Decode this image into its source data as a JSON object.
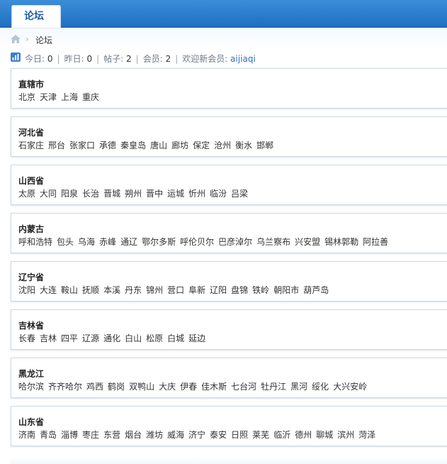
{
  "tabs": {
    "forum": "论坛"
  },
  "breadcrumb": {
    "current": "论坛"
  },
  "stats": {
    "today_label": "今日:",
    "today_value": "0",
    "yesterday_label": "昨日:",
    "yesterday_value": "0",
    "posts_label": "帖子:",
    "posts_value": "2",
    "members_label": "会员:",
    "members_value": "2",
    "welcome_label": "欢迎新会员:",
    "welcome_user": "aijiaqi"
  },
  "provinces": [
    {
      "name": "直辖市",
      "cities": [
        "北京",
        "天津",
        "上海",
        "重庆"
      ]
    },
    {
      "name": "河北省",
      "cities": [
        "石家庄",
        "邢台",
        "张家口",
        "承德",
        "秦皇岛",
        "唐山",
        "廊坊",
        "保定",
        "沧州",
        "衡水",
        "邯郸"
      ]
    },
    {
      "name": "山西省",
      "cities": [
        "太原",
        "大同",
        "阳泉",
        "长治",
        "晋城",
        "朔州",
        "晋中",
        "运城",
        "忻州",
        "临汾",
        "吕梁"
      ]
    },
    {
      "name": "内蒙古",
      "cities": [
        "呼和浩特",
        "包头",
        "乌海",
        "赤峰",
        "通辽",
        "鄂尔多斯",
        "呼伦贝尔",
        "巴彦淖尔",
        "乌兰察布",
        "兴安盟",
        "锡林郭勒",
        "阿拉善"
      ]
    },
    {
      "name": "辽宁省",
      "cities": [
        "沈阳",
        "大连",
        "鞍山",
        "抚顺",
        "本溪",
        "丹东",
        "锦州",
        "营口",
        "阜新",
        "辽阳",
        "盘锦",
        "铁岭",
        "朝阳市",
        "葫芦岛"
      ]
    },
    {
      "name": "吉林省",
      "cities": [
        "长春",
        "吉林",
        "四平",
        "辽源",
        "通化",
        "白山",
        "松原",
        "白城",
        "延边"
      ]
    },
    {
      "name": "黑龙江",
      "cities": [
        "哈尔滨",
        "齐齐哈尔",
        "鸡西",
        "鹤岗",
        "双鸭山",
        "大庆",
        "伊春",
        "佳木斯",
        "七台河",
        "牡丹江",
        "黑河",
        "绥化",
        "大兴安岭"
      ]
    },
    {
      "name": "山东省",
      "cities": [
        "济南",
        "青岛",
        "淄博",
        "枣庄",
        "东营",
        "烟台",
        "潍坊",
        "威海",
        "济宁",
        "泰安",
        "日照",
        "莱芜",
        "临沂",
        "德州",
        "聊城",
        "滨州",
        "菏泽"
      ]
    }
  ],
  "colors": {
    "header_blue": "#1e6fc1",
    "link_blue": "#2b6fba"
  }
}
